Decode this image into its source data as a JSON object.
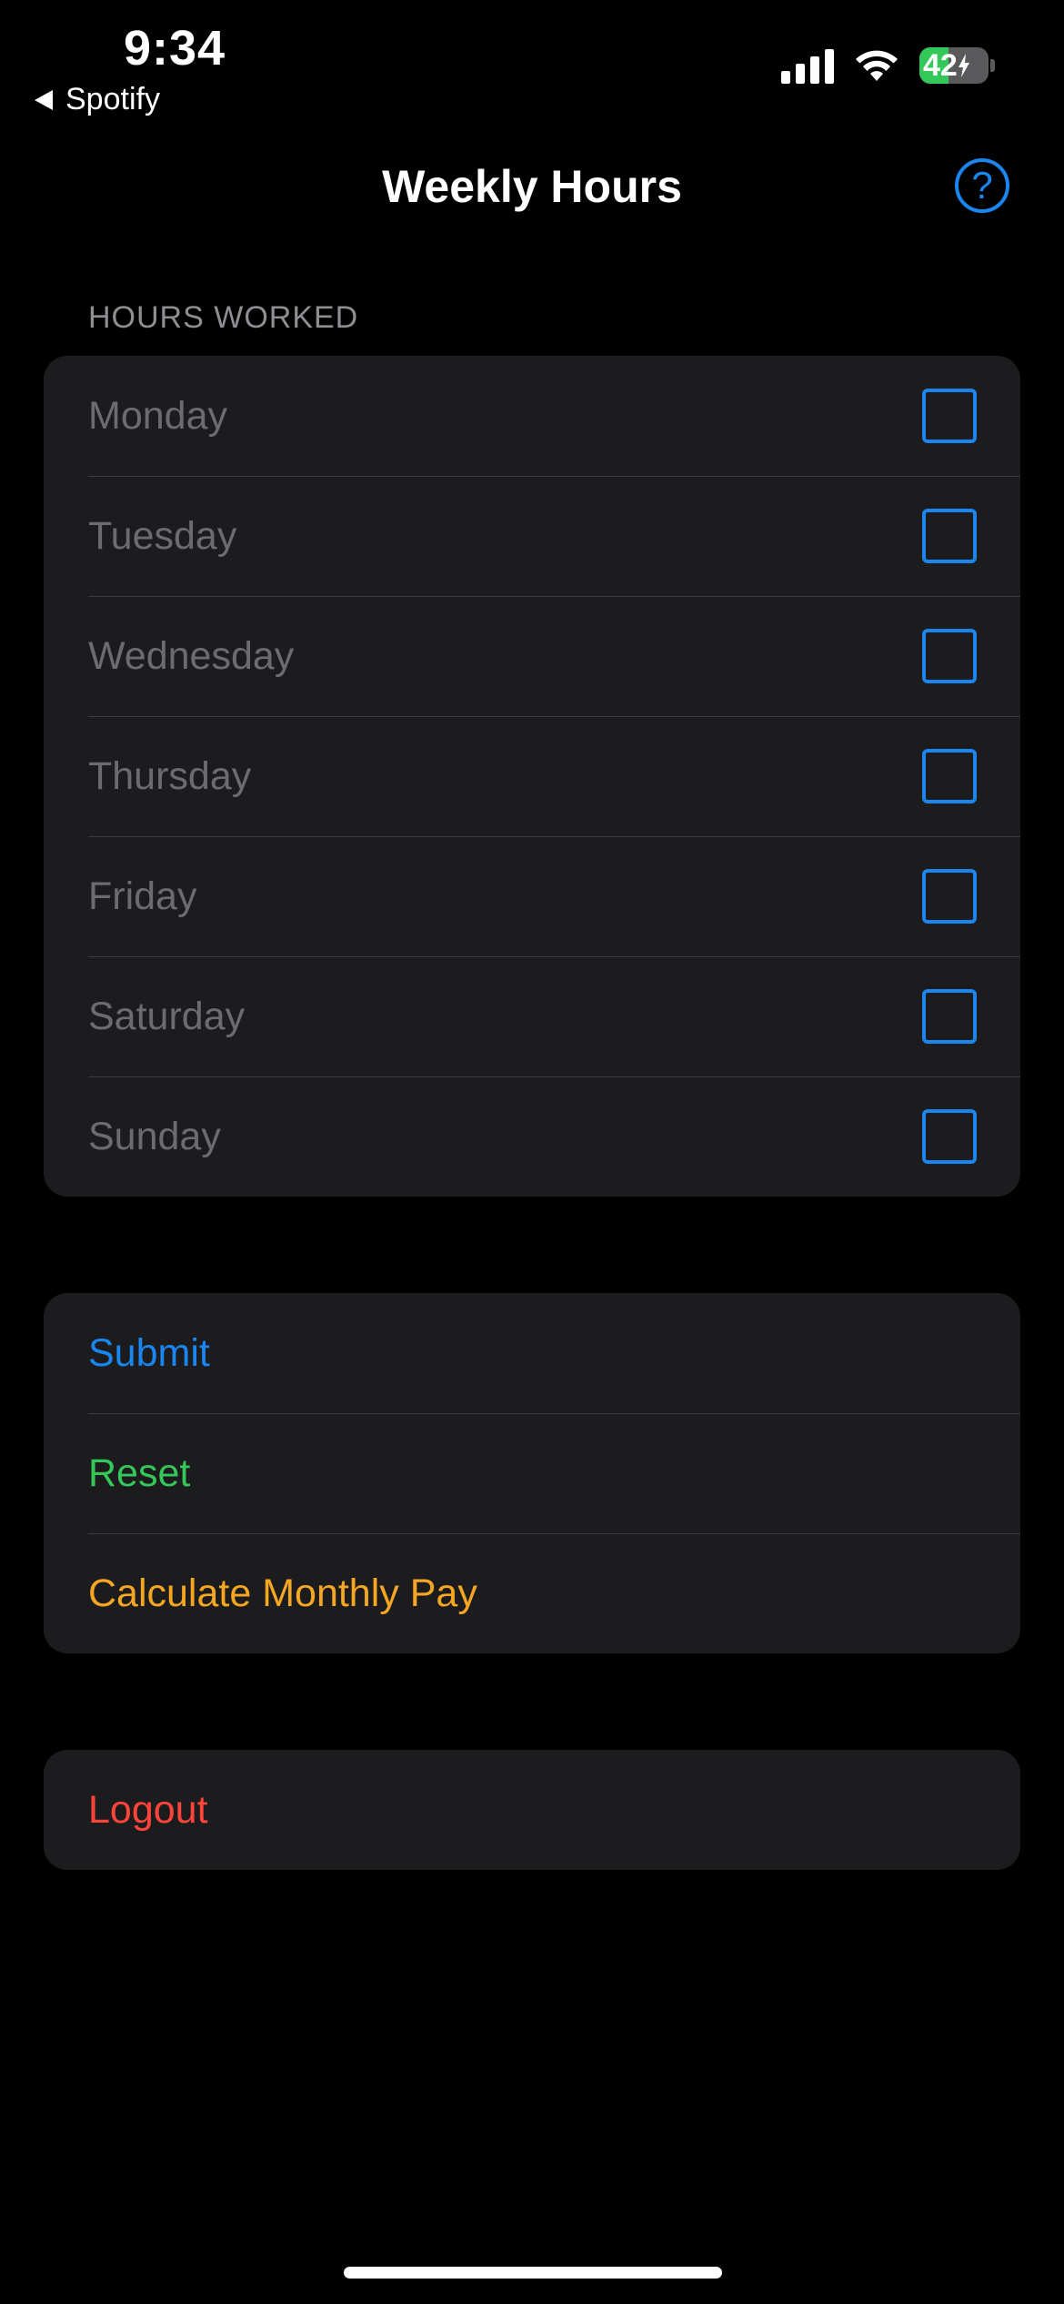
{
  "status_bar": {
    "time": "9:34",
    "back_app": "Spotify",
    "battery_percent": "42",
    "battery_level": 0.42,
    "signal_bars": 4,
    "icons": [
      "back-triangle-icon",
      "cellular-signal-icon",
      "wifi-icon",
      "battery-charging-icon"
    ]
  },
  "nav": {
    "title": "Weekly Hours",
    "help_icon": "question-mark-circle-icon",
    "help_glyph": "?"
  },
  "hours_section": {
    "header": "HOURS WORKED",
    "days": [
      {
        "label": "Monday",
        "checked": false
      },
      {
        "label": "Tuesday",
        "checked": false
      },
      {
        "label": "Wednesday",
        "checked": false
      },
      {
        "label": "Thursday",
        "checked": false
      },
      {
        "label": "Friday",
        "checked": false
      },
      {
        "label": "Saturday",
        "checked": false
      },
      {
        "label": "Sunday",
        "checked": false
      }
    ]
  },
  "actions": {
    "submit": "Submit",
    "reset": "Reset",
    "calculate": "Calculate Monthly Pay"
  },
  "logout": {
    "label": "Logout"
  },
  "colors": {
    "accent_blue": "#1a86f0",
    "reset_green": "#34c759",
    "calculate_orange": "#f5a623",
    "logout_red": "#ff453a",
    "cell_background": "#1c1c1e",
    "placeholder_gray": "#6c6c70"
  }
}
